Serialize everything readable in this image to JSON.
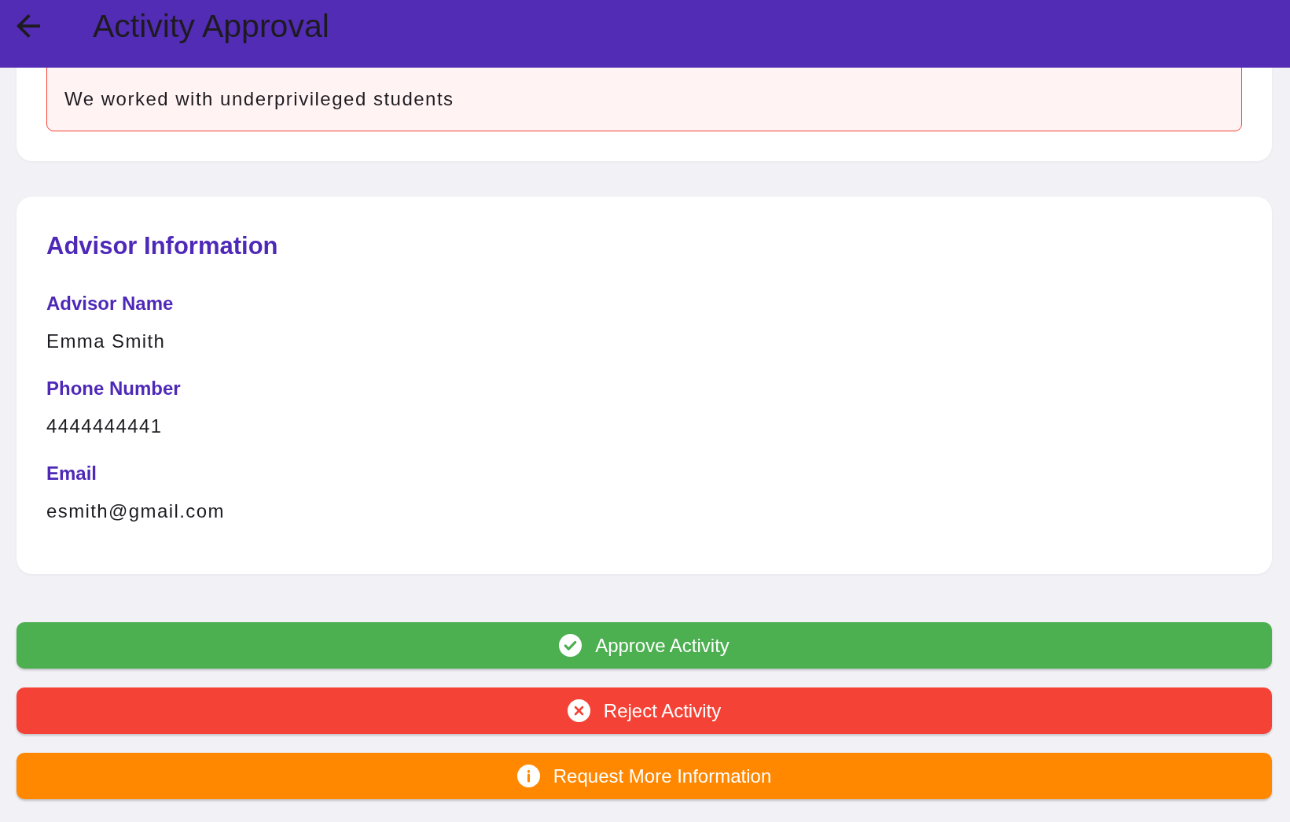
{
  "app_bar": {
    "title": "Activity Approval"
  },
  "activity_card": {
    "description": "We worked with underprivileged students"
  },
  "advisor_card": {
    "title": "Advisor Information",
    "fields": [
      {
        "label": "Advisor Name",
        "value": "Emma Smith"
      },
      {
        "label": "Phone Number",
        "value": "4444444441"
      },
      {
        "label": "Email",
        "value": "esmith@gmail.com"
      }
    ]
  },
  "actions": [
    {
      "kind": "approve",
      "label": "Approve Activity",
      "color": "#4caf50"
    },
    {
      "kind": "reject",
      "label": "Reject Activity",
      "color": "#f44336"
    },
    {
      "kind": "request_info",
      "label": "Request More Information",
      "color": "#ff8800"
    }
  ]
}
